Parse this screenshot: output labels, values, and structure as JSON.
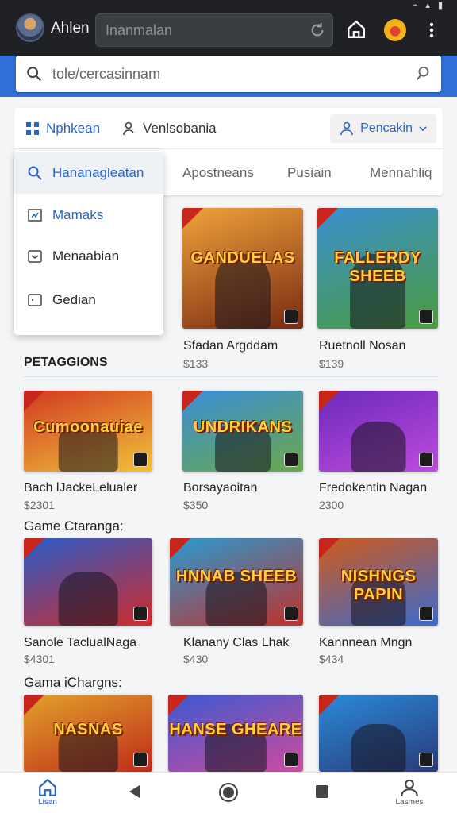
{
  "app": {
    "name": "Ahlen",
    "top_search_placeholder": "Inanmalan"
  },
  "search": {
    "placeholder": "tole/cercasinnam"
  },
  "filters": {
    "tab1": "Nphkean",
    "tab2": "Venlsobania",
    "sort_label": "Pencakin",
    "categories": [
      "Apostneans",
      "Pusiain",
      "Mennahliq"
    ]
  },
  "dropdown": {
    "items": [
      "Hananagleatan",
      "Mamaks",
      "Menaabian",
      "Gedian"
    ]
  },
  "sections": {
    "s1": "PETAGGIONS",
    "s2": "Game Ctaranga:",
    "s3": "Gama iChargns:"
  },
  "games": [
    {
      "title": "GANDUELAS",
      "name": "Sfadan Argddam",
      "price": "$133",
      "colors": [
        "#f0a23a",
        "#7a2a12"
      ]
    },
    {
      "title": "FALLERDY SHEEB",
      "name": "Ruetnoll Nosan",
      "price": "$139",
      "colors": [
        "#3a8fd0",
        "#4a9c3c"
      ]
    },
    {
      "title": "Cumoonauiae",
      "name": "Bach lJackeLelualer",
      "price": "$2301",
      "colors": [
        "#d23a22",
        "#f0c23a"
      ]
    },
    {
      "title": "UNDRIKANS",
      "name": "Borsayaoitan",
      "price": "$350",
      "colors": [
        "#3a8ed8",
        "#6aa84a"
      ]
    },
    {
      "title": "",
      "name": "Fredokentin Nagan",
      "price": "2300",
      "colors": [
        "#6a2ab8",
        "#c04ae0"
      ]
    },
    {
      "title": "",
      "name": "Sanole TaclualNaga",
      "price": "$4301",
      "colors": [
        "#2a5cc8",
        "#d02a2a"
      ]
    },
    {
      "title": "HNNAB SHEEB",
      "name": "Klanany Clas Lhak",
      "price": "$430",
      "colors": [
        "#2a9ad0",
        "#c0302a"
      ]
    },
    {
      "title": "NISHNGS PAPIN",
      "name": "Kannnean Mngn",
      "price": "$434",
      "colors": [
        "#d05a1a",
        "#3a6ad0"
      ]
    },
    {
      "title": "NASNAS",
      "name": "",
      "price": "",
      "colors": [
        "#e0a22a",
        "#c02a1a"
      ]
    },
    {
      "title": "HANSE GHEARE",
      "name": "",
      "price": "",
      "colors": [
        "#3a5ad0",
        "#d04aa0"
      ]
    },
    {
      "title": "",
      "name": "",
      "price": "",
      "colors": [
        "#2a8ad8",
        "#2a3a7a"
      ]
    }
  ],
  "nav": {
    "home": "Lisan",
    "profile": "Lasmes"
  }
}
